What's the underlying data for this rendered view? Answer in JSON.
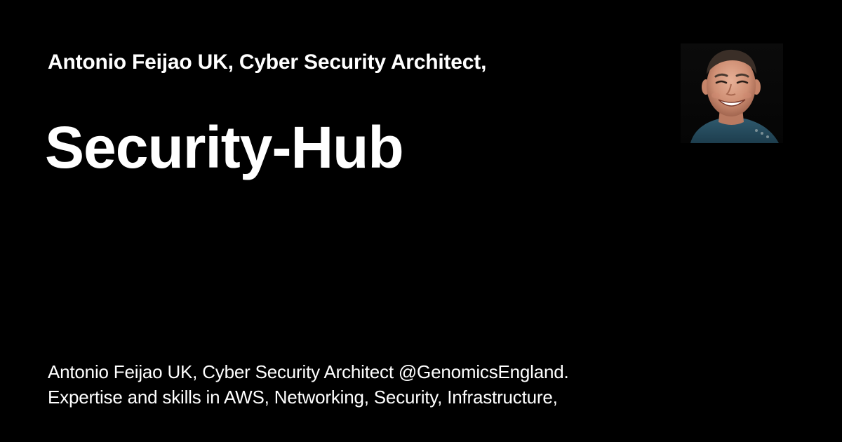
{
  "card": {
    "author_line": "Antonio Feijao UK, Cyber Security Architect,",
    "title": "Security-Hub",
    "description_line_1": "Antonio Feijao UK, Cyber Security Architect @GenomicsEngland.",
    "description_line_2": "Expertise and skills in AWS, Networking, Security, Infrastructure,"
  },
  "avatar": {
    "icon": "profile-photo"
  },
  "colors": {
    "background": "#000000",
    "text": "#ffffff"
  }
}
